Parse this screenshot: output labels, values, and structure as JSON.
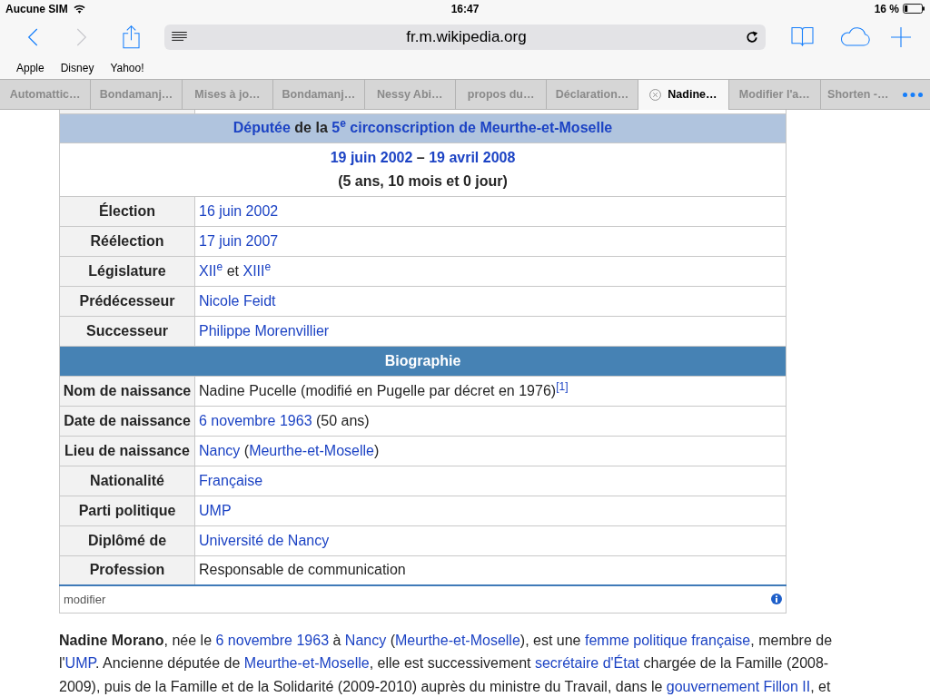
{
  "status_bar": {
    "carrier": "Aucune SIM",
    "time": "16:47",
    "battery": "16 %"
  },
  "address_bar": {
    "url": "fr.m.wikipedia.org"
  },
  "bookmarks": [
    "Apple",
    "Disney",
    "Yahoo!"
  ],
  "tabs": [
    {
      "label": "Automattic…",
      "selected": false
    },
    {
      "label": "Bondamanj…",
      "selected": false
    },
    {
      "label": "Mises à jo…",
      "selected": false
    },
    {
      "label": "Bondamanj…",
      "selected": false
    },
    {
      "label": "Nessy Abi…",
      "selected": false
    },
    {
      "label": "propos du…",
      "selected": false
    },
    {
      "label": "Déclaration…",
      "selected": false
    },
    {
      "label": "Nadine…",
      "selected": true
    },
    {
      "label": "Modifier l'a…",
      "selected": false
    },
    {
      "label": "Shorten -…",
      "selected": false
    }
  ],
  "infobox": {
    "mandate_title": [
      {
        "text": "Députée",
        "link": true
      },
      {
        "text": " de la ",
        "link": false
      },
      {
        "text": "5$^{e}$ circonscription de Meurthe-et-Moselle",
        "link": true
      }
    ],
    "mandate_period": [
      {
        "text": "19 juin 2002",
        "link": true
      },
      {
        "text": " – ",
        "link": false
      },
      {
        "text": "19 avril 2008",
        "link": true
      }
    ],
    "mandate_duration": "(5 ans, 10 mois et 0 jour)",
    "mandate_rows": [
      {
        "label": "Élection",
        "value": [
          {
            "text": "16 juin 2002",
            "link": true
          }
        ]
      },
      {
        "label": "Réélection",
        "value": [
          {
            "text": "17 juin 2007",
            "link": true
          }
        ]
      },
      {
        "label": "Législature",
        "value": [
          {
            "text": "XII$^{e}$",
            "link": true
          },
          {
            "text": " et ",
            "link": false
          },
          {
            "text": "XIII$^{e}$",
            "link": true
          }
        ]
      },
      {
        "label": "Prédécesseur",
        "value": [
          {
            "text": "Nicole Feidt",
            "link": true
          }
        ]
      },
      {
        "label": "Successeur",
        "value": [
          {
            "text": "Philippe Morenvillier",
            "link": true
          }
        ]
      }
    ],
    "section_title": "Biographie",
    "bio_rows": [
      {
        "label": "Nom de naissance",
        "value": [
          {
            "text": "Nadine Pucelle (modifié en Pugelle par décret en 1976)",
            "link": false
          },
          {
            "text": "$^{[1]}$",
            "link": true
          }
        ]
      },
      {
        "label": "Date de naissance",
        "value": [
          {
            "text": "6 novembre 1963",
            "link": true
          },
          {
            "text": " (50 ans)",
            "link": false
          }
        ]
      },
      {
        "label": "Lieu de naissance",
        "value": [
          {
            "text": "Nancy",
            "link": true
          },
          {
            "text": " (",
            "link": false
          },
          {
            "text": "Meurthe-et-Moselle",
            "link": true
          },
          {
            "text": ")",
            "link": false
          }
        ]
      },
      {
        "label": "Nationalité",
        "value": [
          {
            "text": "Française",
            "link": true
          }
        ]
      },
      {
        "label": "Parti politique",
        "value": [
          {
            "text": "UMP",
            "link": true
          }
        ]
      },
      {
        "label": "Diplômé de",
        "value": [
          {
            "text": "Université de Nancy",
            "link": true
          }
        ]
      },
      {
        "label": "Profession",
        "value": [
          {
            "text": "Responsable de communication",
            "link": false
          }
        ]
      }
    ],
    "edit_link": "modifier"
  },
  "article": {
    "paragraph": [
      {
        "text": "**Nadine Morano**, née le ",
        "link": false
      },
      {
        "text": "6 novembre 1963",
        "link": true
      },
      {
        "text": " à ",
        "link": false
      },
      {
        "text": "Nancy",
        "link": true
      },
      {
        "text": " (",
        "link": false
      },
      {
        "text": "Meurthe-et-Moselle",
        "link": true
      },
      {
        "text": "), est une ",
        "link": false
      },
      {
        "text": "femme politique française",
        "link": true
      },
      {
        "text": ", membre de l'",
        "link": false
      },
      {
        "text": "UMP",
        "link": true
      },
      {
        "text": ". Ancienne députée de ",
        "link": false
      },
      {
        "text": "Meurthe-et-Moselle",
        "link": true
      },
      {
        "text": ", elle est successivement ",
        "link": false
      },
      {
        "text": "secrétaire d'État",
        "link": true
      },
      {
        "text": " chargée de la Famille (2008-",
        "link": false
      },
      {
        "text": "2009), puis de la Famille et de la Solidarité (2009-2010) auprès du ministre du Travail, dans le ",
        "link": false
      },
      {
        "text": "gouvernement Fillon II",
        "link": true
      },
      {
        "text": ", et",
        "link": false
      }
    ]
  }
}
